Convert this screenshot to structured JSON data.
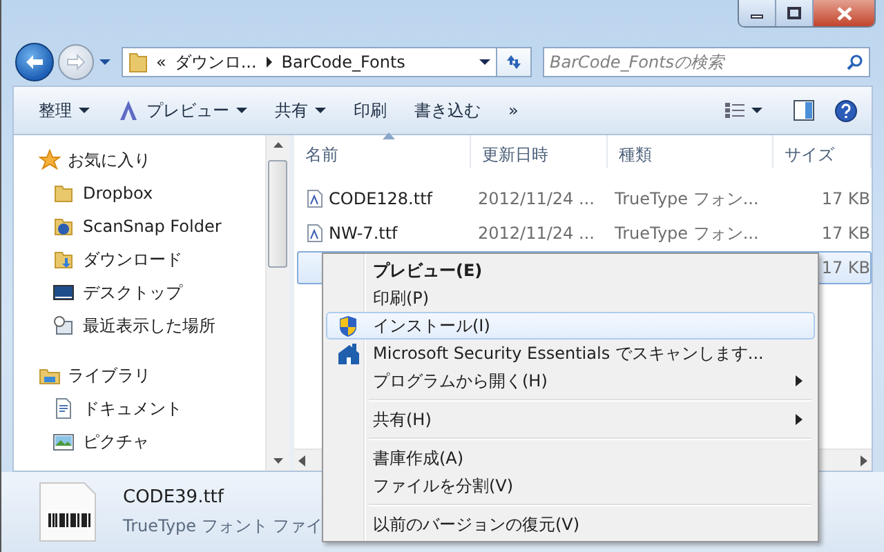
{
  "address_bar": {
    "overflow": "«",
    "segments": [
      "ダウンロ...",
      "BarCode_Fonts"
    ]
  },
  "search": {
    "placeholder": "BarCode_Fontsの検索"
  },
  "toolbar": {
    "buttons": [
      {
        "label": "整理",
        "dropdown": true
      },
      {
        "label": "プレビュー",
        "dropdown": true
      },
      {
        "label": "共有",
        "dropdown": true
      },
      {
        "label": "印刷",
        "dropdown": false
      },
      {
        "label": "書き込む",
        "dropdown": false
      },
      {
        "label": "»",
        "dropdown": false
      }
    ]
  },
  "sidebar": {
    "groups": [
      {
        "label": "お気に入り",
        "items": [
          "Dropbox",
          "ScanSnap Folder",
          "ダウンロード",
          "デスクトップ",
          "最近表示した場所"
        ]
      },
      {
        "label": "ライブラリ",
        "items": [
          "ドキュメント",
          "ピクチャ"
        ]
      }
    ]
  },
  "file_list": {
    "columns": [
      {
        "label": "名前",
        "sorted": true
      },
      {
        "label": "更新日時",
        "sorted": false
      },
      {
        "label": "種類",
        "sorted": false
      },
      {
        "label": "サイズ",
        "sorted": false
      }
    ],
    "rows": [
      {
        "name": "CODE128.ttf",
        "modified": "2012/11/24 ...",
        "type": "TrueType フォン...",
        "size": "17 KB",
        "selected": false
      },
      {
        "name": "NW-7.ttf",
        "modified": "2012/11/24 ...",
        "type": "TrueType フォン...",
        "size": "17 KB",
        "selected": false
      },
      {
        "size": "17 KB",
        "selected": true
      }
    ]
  },
  "details": {
    "file_name": "CODE39.ttf",
    "file_type": "TrueType フォント ファイ"
  },
  "context_menu": {
    "items": [
      {
        "kind": "item",
        "label": "プレビュー(E)",
        "default": true,
        "highlighted": false,
        "submenu": false
      },
      {
        "kind": "item",
        "label": "印刷(P)",
        "default": false,
        "highlighted": false,
        "submenu": false
      },
      {
        "kind": "item",
        "label": "インストール(I)",
        "default": false,
        "highlighted": true,
        "submenu": false
      },
      {
        "kind": "item",
        "label": "Microsoft Security Essentials でスキャンします...",
        "default": false,
        "highlighted": false,
        "submenu": false
      },
      {
        "kind": "item",
        "label": "プログラムから開く(H)",
        "default": false,
        "highlighted": false,
        "submenu": true
      },
      {
        "kind": "separator"
      },
      {
        "kind": "item",
        "label": "共有(H)",
        "default": false,
        "highlighted": false,
        "submenu": true
      },
      {
        "kind": "separator"
      },
      {
        "kind": "item",
        "label": "書庫作成(A)",
        "default": false,
        "highlighted": false,
        "submenu": false
      },
      {
        "kind": "item",
        "label": "ファイルを分割(V)",
        "default": false,
        "highlighted": false,
        "submenu": false
      },
      {
        "kind": "separator"
      },
      {
        "kind": "item",
        "label": "以前のバージョンの復元(V)",
        "default": false,
        "highlighted": false,
        "submenu": false
      }
    ]
  }
}
